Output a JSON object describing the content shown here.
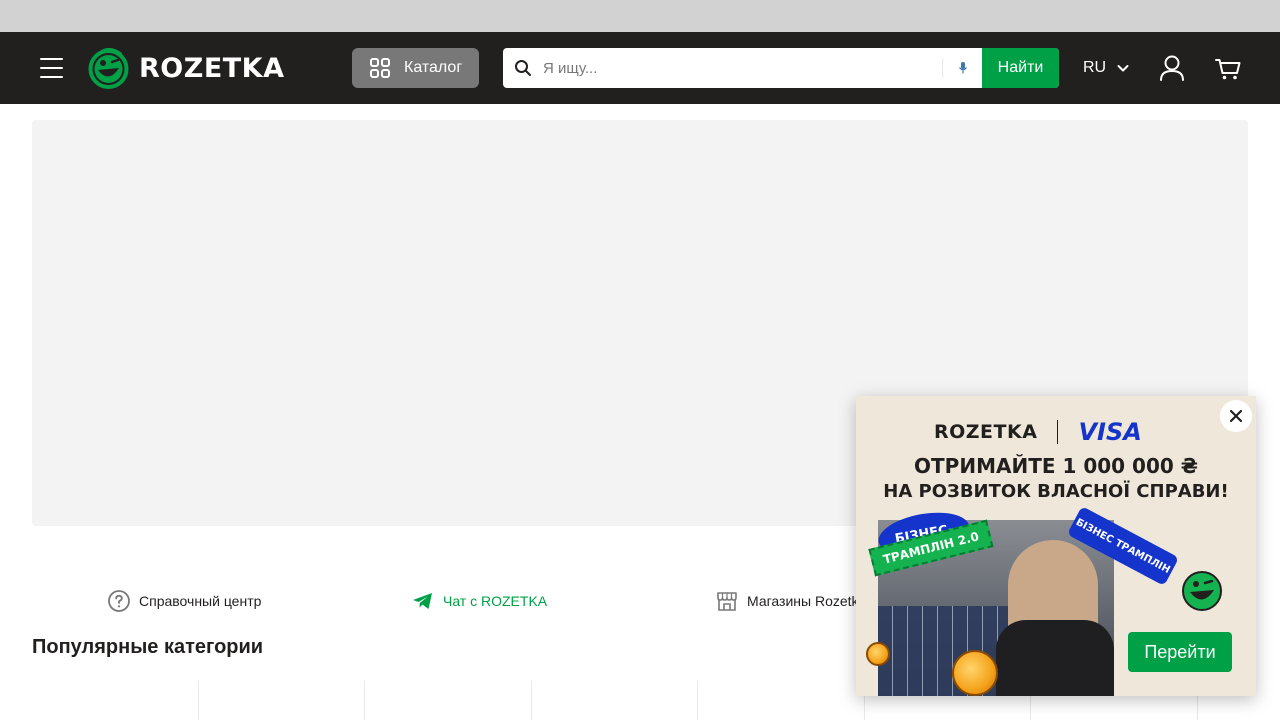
{
  "header": {
    "logo_text": "ROZETKA",
    "catalog_label": "Каталог",
    "search": {
      "placeholder": "Я ищу...",
      "submit_label": "Найти"
    },
    "language": "RU"
  },
  "service_links": [
    {
      "label": "Справочный центр",
      "icon": "help-circle-icon"
    },
    {
      "label": "Чат с ROZETKA",
      "icon": "telegram-icon"
    },
    {
      "label": "Магазины Rozetk",
      "icon": "store-icon"
    }
  ],
  "popular": {
    "title": "Популярные категории"
  },
  "popup": {
    "brand": "ROZETKA",
    "partner": "VISA",
    "headline_1": "ОТРИМАЙТЕ 1 000 000 ₴",
    "headline_2": "НА РОЗВИТОК ВЛАСНОЇ СПРАВИ!",
    "tag_1": "БІЗНЕС-",
    "tag_2": "ТРАМПЛІН 2.0",
    "tag_3": "БІЗНЕС ТРАМПЛІН",
    "cta_label": "Перейти"
  },
  "colors": {
    "brand_green": "#00a046",
    "header_bg": "#221f1f",
    "catalog_bg": "#797878",
    "visa_blue": "#1434cb"
  }
}
